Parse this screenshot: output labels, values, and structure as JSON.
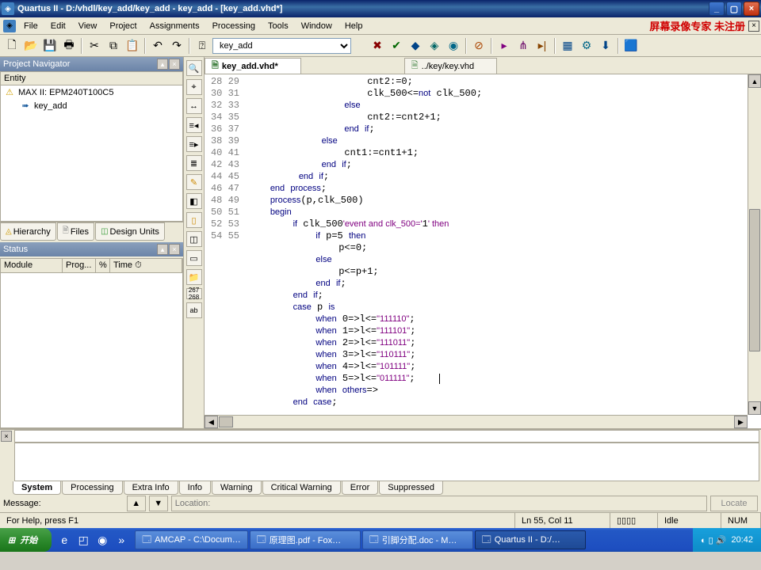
{
  "title": "Quartus II - D:/vhdl/key_add/key_add - key_add - [key_add.vhd*]",
  "watermark": "屏幕录像专家 未注册",
  "menus": [
    "File",
    "Edit",
    "View",
    "Project",
    "Assignments",
    "Processing",
    "Tools",
    "Window",
    "Help"
  ],
  "toolbar_target": "key_add",
  "nav": {
    "title": "Project Navigator",
    "entity_col": "Entity",
    "root": "MAX II: EPM240T100C5",
    "child": "key_add",
    "tabs": [
      "Hierarchy",
      "Files",
      "Design Units"
    ]
  },
  "status_panel": {
    "title": "Status",
    "cols": [
      "Module",
      "Prog...",
      "%",
      "Time ⏱"
    ]
  },
  "editor_tabs": [
    {
      "label": "key_add.vhd*",
      "active": true
    },
    {
      "label": "../key/key.vhd",
      "active": false
    }
  ],
  "code_first_line": 28,
  "code": [
    "                     cnt2:=0;",
    "                     clk_500<=not clk_500;",
    "                 else",
    "                     cnt2:=cnt2+1;",
    "                 end if;",
    "             else",
    "                 cnt1:=cnt1+1;",
    "             end if;",
    "         end if;",
    "    end process;",
    "    process(p,clk_500)",
    "    begin",
    "        if clk_500'event and clk_500='1' then",
    "            if p=5 then",
    "                p<=0;",
    "            else",
    "                p<=p+1;",
    "            end if;",
    "        end if;",
    "        case p is",
    "            when 0=>l<=\"111110\";",
    "            when 1=>l<=\"111101\";",
    "            when 2=>l<=\"111011\";",
    "            when 3=>l<=\"110111\";",
    "            when 4=>l<=\"101111\";",
    "            when 5=>l<=\"011111\";",
    "            when others=>",
    "        end case;"
  ],
  "keywords": [
    "else",
    "end",
    "if",
    "process",
    "begin",
    "and",
    "then",
    "case",
    "is",
    "when",
    "others",
    "not"
  ],
  "msg_tabs": [
    "System",
    "Processing",
    "Extra Info",
    "Info",
    "Warning",
    "Critical Warning",
    "Error",
    "Suppressed"
  ],
  "msg_footer": {
    "label": "Message:",
    "location": "Location:",
    "locate": "Locate"
  },
  "statusbar": {
    "help": "For Help, press F1",
    "pos": "Ln 55, Col 11",
    "idle": "Idle",
    "num": "NUM"
  },
  "taskbar": {
    "start": "开始",
    "items": [
      "AMCAP - C:\\Docum…",
      "原理图.pdf - Fox…",
      "引脚分配.doc - M…",
      "Quartus II - D:/…"
    ],
    "time": "20:42"
  }
}
